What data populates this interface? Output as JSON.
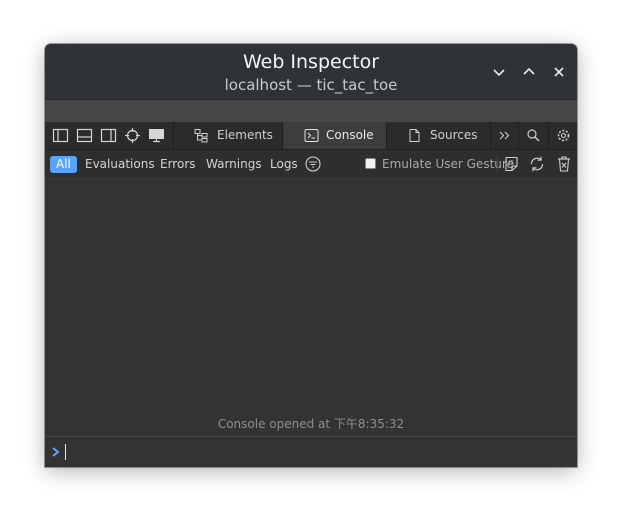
{
  "window": {
    "title": "Web Inspector",
    "subtitle": "localhost — tic_tac_toe",
    "controls": [
      "minimize-icon",
      "maximize-icon",
      "close-icon"
    ]
  },
  "tabbar": {
    "layout_icons": [
      "dock-left-icon",
      "dock-bottom-icon",
      "dock-right-icon",
      "inspect-element-icon",
      "device-settings-icon"
    ],
    "tabs": [
      {
        "label": "Elements",
        "icon": "elements-icon",
        "active": false
      },
      {
        "label": "Console",
        "icon": "console-icon",
        "active": true
      },
      {
        "label": "Sources",
        "icon": "sources-icon",
        "active": false
      }
    ],
    "right_icons": [
      "more-tabs-icon",
      "search-icon",
      "settings-icon"
    ]
  },
  "filterbar": {
    "tabs": [
      {
        "label": "All",
        "active": true
      },
      {
        "label": "Evaluations",
        "active": false
      },
      {
        "label": "Errors",
        "active": false
      },
      {
        "label": "Warnings",
        "active": false
      },
      {
        "label": "Logs",
        "active": false
      }
    ],
    "filter_icon": "filter-icon",
    "emulate_user_gesture": {
      "label": "Emulate User Gesture",
      "checked": false
    },
    "action_icons": [
      "evaluate-js-icon",
      "clear-reload-icon",
      "clear-log-icon"
    ]
  },
  "console": {
    "message": "Console opened at 下午8:35:32",
    "input_value": ""
  },
  "colors": {
    "accent": "#5aa4f5",
    "background": "#333333",
    "titlebar": "#2f3236"
  }
}
